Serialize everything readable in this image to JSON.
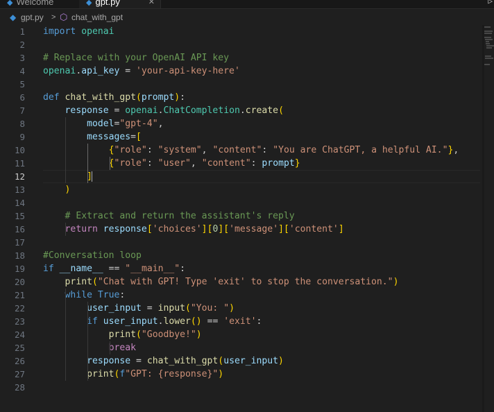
{
  "tabs": [
    {
      "label": "Welcome",
      "icon": "vscode-icon",
      "active": false
    },
    {
      "label": "gpt.py",
      "icon": "python-file-icon",
      "active": true
    }
  ],
  "breadcrumb": {
    "file": "gpt.py",
    "file_icon": "python-file-icon",
    "separator": ">",
    "symbol": "chat_with_gpt",
    "symbol_icon": "method-symbol-icon"
  },
  "editor": {
    "language": "python",
    "current_line": 12,
    "line_numbers": [
      "1",
      "2",
      "3",
      "4",
      "5",
      "6",
      "7",
      "8",
      "9",
      "10",
      "11",
      "12",
      "13",
      "14",
      "15",
      "16",
      "17",
      "18",
      "19",
      "20",
      "21",
      "22",
      "23",
      "24",
      "25",
      "26",
      "27",
      "28"
    ],
    "lines": [
      "import openai",
      "",
      "# Replace with your OpenAI API key",
      "openai.api_key = 'your-api-key-here'",
      "",
      "def chat_with_gpt(prompt):",
      "    response = openai.ChatCompletion.create(",
      "        model=\"gpt-4\",",
      "        messages=[",
      "            {\"role\": \"system\", \"content\": \"You are ChatGPT, a helpful AI.\"},",
      "            {\"role\": \"user\", \"content\": prompt}",
      "        ]",
      "    )",
      "",
      "    # Extract and return the assistant's reply",
      "    return response['choices'][0]['message']['content']",
      "",
      "#Conversation loop",
      "if __name__ == \"__main__\":",
      "    print(\"Chat with GPT! Type 'exit' to stop the conversation.\")",
      "    while True:",
      "        user_input = input(\"You: \")",
      "        if user_input.lower() == 'exit':",
      "            print(\"Goodbye!\")",
      "            break",
      "        response = chat_with_gpt(user_input)",
      "        print(f\"GPT: {response}\")",
      ""
    ]
  },
  "colors": {
    "background": "#1f1f1f",
    "keyword": "#569cd6",
    "control": "#c586c0",
    "function": "#dcdcaa",
    "variable": "#9cdcfe",
    "string": "#ce9178",
    "comment": "#6a9955",
    "number": "#b5cea8"
  }
}
